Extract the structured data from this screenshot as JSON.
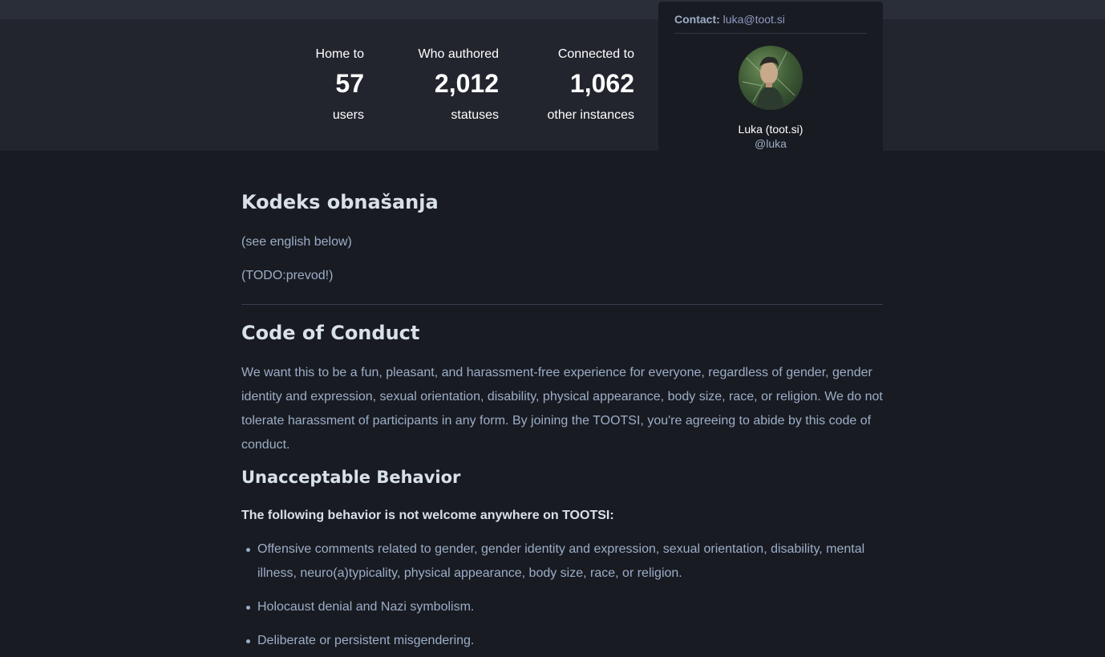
{
  "stats": {
    "users": {
      "label": "Home to",
      "value": "57",
      "unit": "users"
    },
    "statuses": {
      "label": "Who authored",
      "value": "2,012",
      "unit": "statuses"
    },
    "instances": {
      "label": "Connected to",
      "value": "1,062",
      "unit": "other instances"
    }
  },
  "contact": {
    "label": "Contact:",
    "email": "luka@toot.si",
    "account_name": "Luka (toot.si)",
    "account_handle": "@luka"
  },
  "content": {
    "heading_sl": "Kodeks obnašanja",
    "note_english": "(see english below)",
    "note_todo": "(TODO:prevod!)",
    "heading_en": "Code of Conduct",
    "intro": "We want this to be a fun, pleasant, and harassment-free experience for everyone, regardless of gender, gender identity and expression, sexual orientation, disability, physical appearance, body size, race, or religion. We do not tolerate harassment of participants in any form. By joining the TOOTSI, you're agreeing to abide by this code of conduct.",
    "unacceptable_heading": "Unacceptable Behavior",
    "unacceptable_lead": "The following behavior is not welcome anywhere on TOOTSI:",
    "rules": [
      "Offensive comments related to gender, gender identity and expression, sexual orientation, disability, mental illness, neuro(a)typicality, physical appearance, body size, race, or religion.",
      "Holocaust denial and Nazi symbolism.",
      "Deliberate or persistent misgendering."
    ]
  },
  "colors": {
    "background": "#191b22",
    "band": "#22252e",
    "heading": "#d9e1e8",
    "text": "#9baec8"
  }
}
